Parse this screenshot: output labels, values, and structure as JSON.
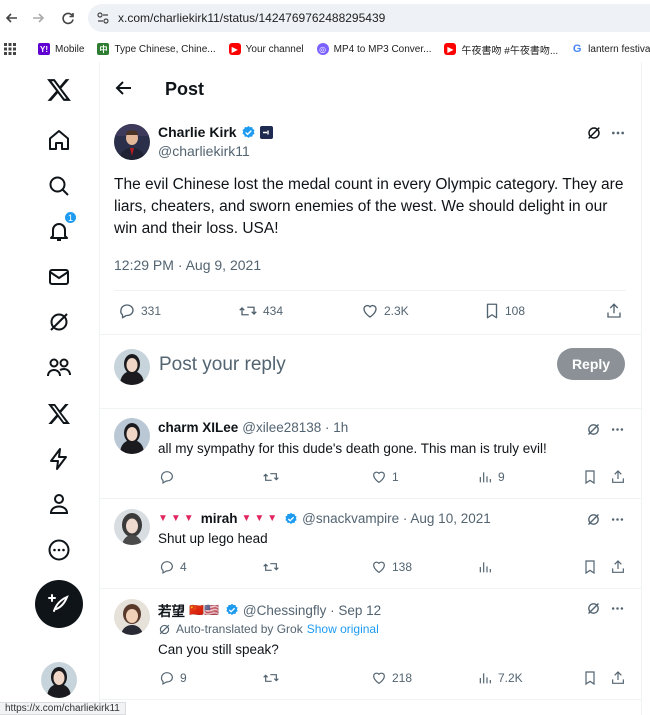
{
  "browser": {
    "url": "x.com/charliekirk11/status/1424769762488295439",
    "status_url": "https://x.com/charliekirk11",
    "bookmarks": [
      {
        "label": "Mobile",
        "icon": "yahoo-icon",
        "color": "#6001d2"
      },
      {
        "label": "Type Chinese, Chine...",
        "icon": "chinese-input-icon",
        "color": "#2e7d32"
      },
      {
        "label": "Your channel",
        "icon": "youtube-icon",
        "color": "#ff0000"
      },
      {
        "label": "MP4 to MP3 Conver...",
        "icon": "converter-icon",
        "color": "#7b61ff"
      },
      {
        "label": "午夜書吻 #午夜書吻...",
        "icon": "youtube-icon",
        "color": "#ff0000"
      },
      {
        "label": "lantern festival",
        "icon": "google-icon",
        "color": "#4285f4"
      }
    ]
  },
  "sidebar": {
    "notification_count": "1"
  },
  "header": {
    "title": "Post"
  },
  "tweet": {
    "author": "Charlie Kirk",
    "handle": "@charliekirk11",
    "text": "The evil Chinese lost the medal count in every Olympic category. They are liars, cheaters, and sworn enemies of the west. We should delight in our win and their loss. USA!",
    "timestamp": "12:29 PM · Aug 9, 2021",
    "stats": {
      "replies": "331",
      "reposts": "434",
      "likes": "2.3K",
      "bookmarks": "108"
    }
  },
  "compose": {
    "placeholder": "Post your reply",
    "reply_label": "Reply"
  },
  "replies": [
    {
      "name": "charm XILee",
      "handle": "@xilee28138 · 1h",
      "text": "all my sympathy for this dude's death gone. This man is truly evil!",
      "replies": "",
      "likes": "1",
      "views": "9"
    },
    {
      "name": "mirah",
      "name_prefix": "▼▼▼",
      "name_suffix": "▼▼▼",
      "handle": "@snackvampire · Aug 10, 2021",
      "text": "Shut up lego head",
      "replies": "4",
      "likes": "138",
      "views": ""
    },
    {
      "name": "若望",
      "flags": "🇨🇳🇺🇸",
      "handle": "@Chessingfly · Sep 12",
      "translated_note": "Auto-translated by Grok",
      "show_original": "Show original",
      "text": "Can you still speak?",
      "replies": "9",
      "likes": "218",
      "views": "7.2K"
    }
  ],
  "colors": {
    "accent": "#1d9bf0",
    "muted": "#536471",
    "text": "#0f1419",
    "reply_button": "#8b9196"
  }
}
